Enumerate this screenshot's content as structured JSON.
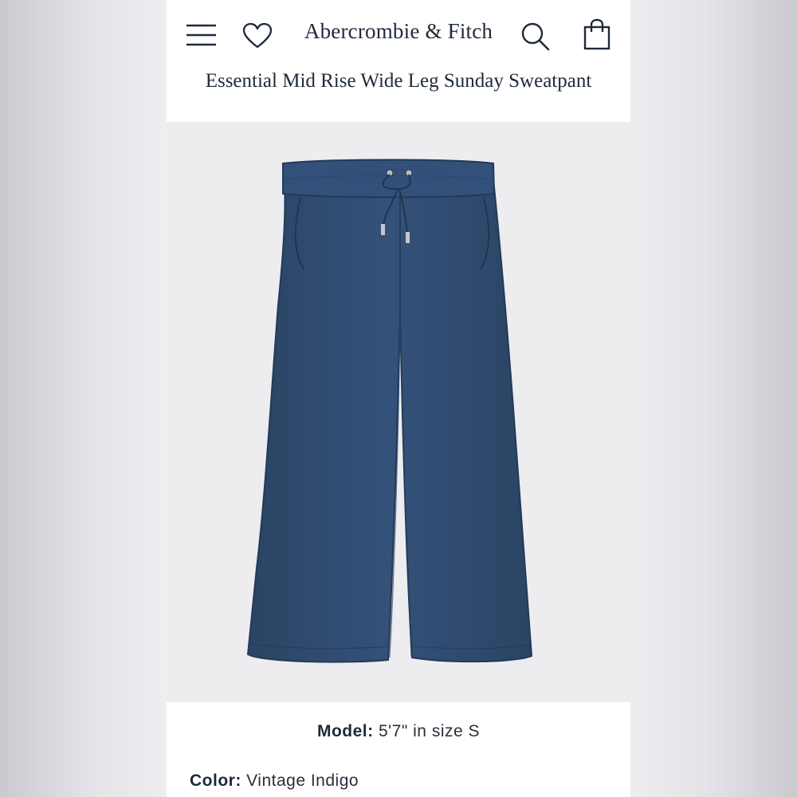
{
  "header": {
    "brand": "Abercrombie & Fitch",
    "icons": {
      "menu": "hamburger-menu-icon",
      "wishlist": "heart-icon",
      "search": "search-icon",
      "bag": "shopping-bag-icon"
    }
  },
  "product": {
    "title": "Essential Mid Rise Wide Leg Sunday Sweatpant",
    "model_label": "Model:",
    "model_value": "5'7\" in size S",
    "color_label": "Color:",
    "color_value": "Vintage Indigo"
  },
  "colors": {
    "text": "#1f2a3a",
    "image_background": "#edecef",
    "garment": "#2f4a6b"
  }
}
